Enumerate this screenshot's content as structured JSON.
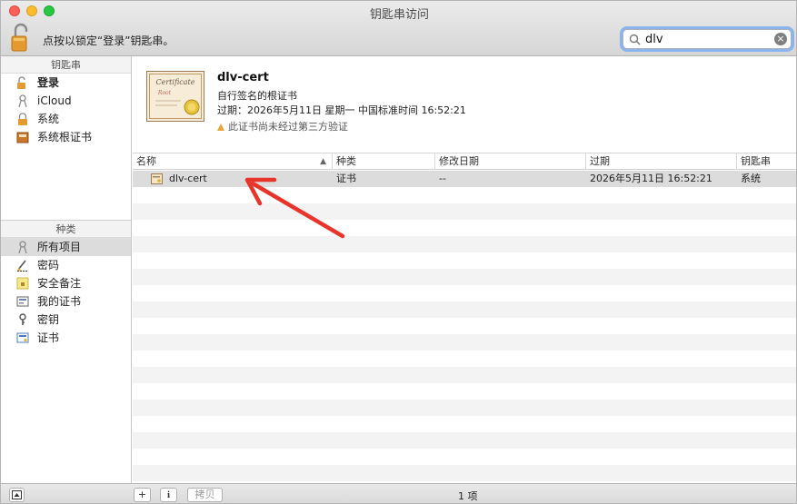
{
  "window": {
    "title": "钥匙串访问"
  },
  "toolbar": {
    "lock_text": "点按以锁定“登录”钥匙串。",
    "search_value": "dlv"
  },
  "sidebar": {
    "keychains_header": "钥匙串",
    "keychains": [
      {
        "label": "登录",
        "icon": "lock-open-icon"
      },
      {
        "label": "iCloud",
        "icon": "keychain-icon"
      },
      {
        "label": "系统",
        "icon": "lock-closed-icon"
      },
      {
        "label": "系统根证书",
        "icon": "cabinet-icon"
      }
    ],
    "categories_header": "种类",
    "categories": [
      {
        "label": "所有项目",
        "icon": "all-items-icon"
      },
      {
        "label": "密码",
        "icon": "password-icon"
      },
      {
        "label": "安全备注",
        "icon": "secure-note-icon"
      },
      {
        "label": "我的证书",
        "icon": "my-certificate-icon"
      },
      {
        "label": "密钥",
        "icon": "key-icon"
      },
      {
        "label": "证书",
        "icon": "certificate-icon"
      }
    ]
  },
  "detail": {
    "name": "dlv-cert",
    "type": "自行签名的根证书",
    "expires": "过期：2026年5月11日 星期一 中国标准时间 16:52:21",
    "warning": "此证书尚未经过第三方验证",
    "cert_image_title": "Certificate",
    "cert_image_subtitle": "Root"
  },
  "table": {
    "columns": [
      "名称",
      "种类",
      "修改日期",
      "过期",
      "钥匙串"
    ],
    "rows": [
      {
        "name": "dlv-cert",
        "kind": "证书",
        "modified": "--",
        "expires": "2026年5月11日 16:52:21",
        "keychain": "系统"
      }
    ]
  },
  "bottombar": {
    "add": "+",
    "info": "i",
    "copy": "拷贝",
    "count": "1 项"
  },
  "colors": {
    "accent": "#8bb3ec",
    "annotation_arrow": "#e8352b",
    "selection": "#dcdcdc"
  }
}
